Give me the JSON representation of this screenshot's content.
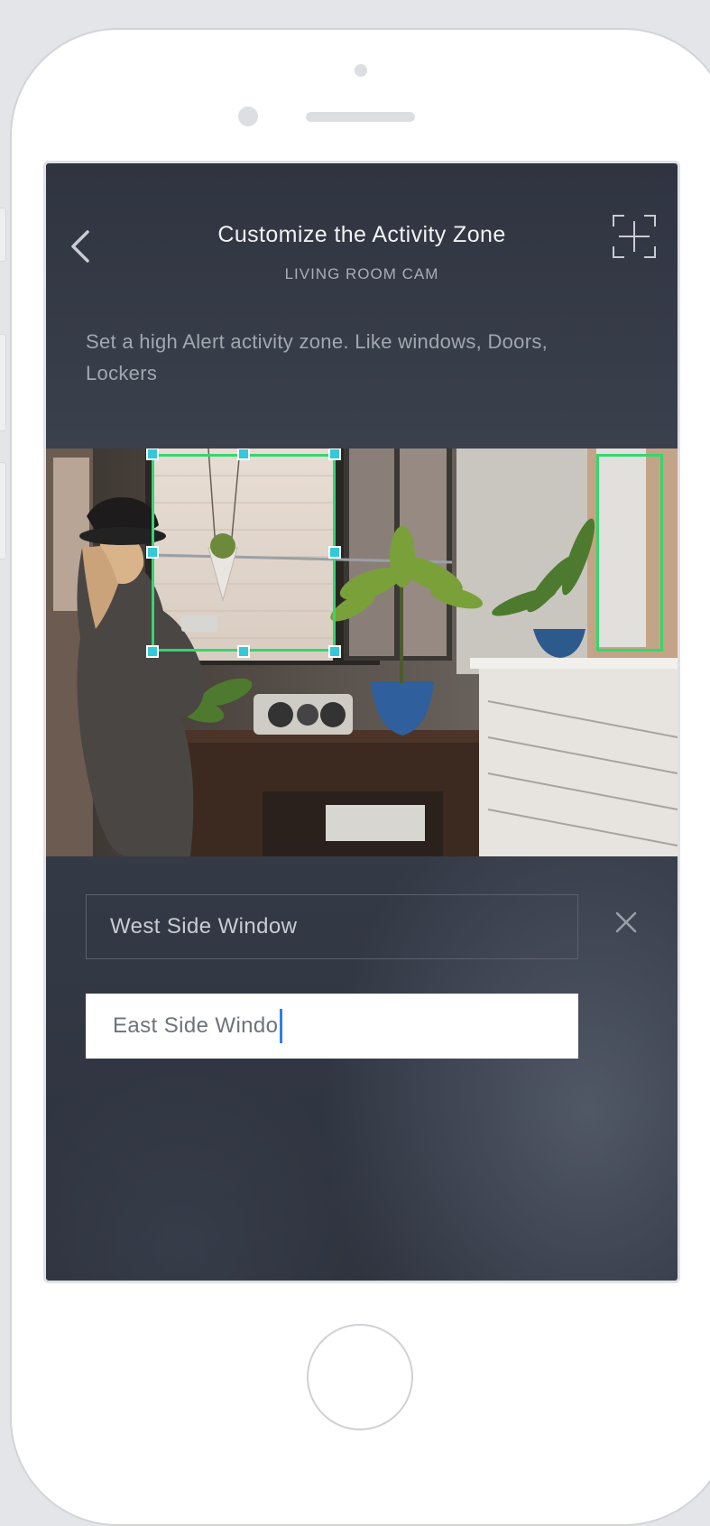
{
  "header": {
    "title": "Customize the Activity Zone",
    "subtitle": "LIVING ROOM CAM"
  },
  "description": "Set a high Alert activity zone. Like windows, Doors, Lockers",
  "icons": {
    "back": "chevron-left-icon",
    "expand": "focus-add-icon",
    "close": "close-icon"
  },
  "colors": {
    "zone_border": "#35d66e",
    "zone_handle": "#35c8d8",
    "caret": "#2f7cf2"
  },
  "zones": [
    {
      "name": "West Side Window"
    },
    {
      "name": "East Side Windo"
    }
  ]
}
